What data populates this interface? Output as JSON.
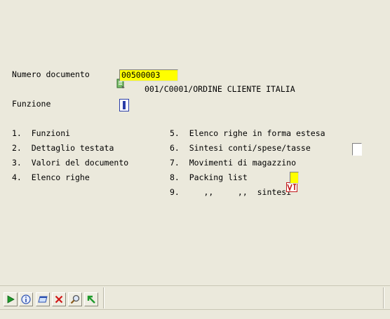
{
  "header": {
    "numero_label": "Numero documento",
    "numero_value": "00500003",
    "doc_description": "001/C0001/ORDINE CLIENTE ITALIA",
    "funzione_label": "Funzione"
  },
  "menu_left": [
    "1.  Funzioni",
    "2.  Dettaglio testata",
    "3.  Valori del documento",
    "4.  Elenco righe"
  ],
  "menu_right": [
    "5.  Elenco righe in forma estesa",
    "6.  Sintesi conti/spese/tasse",
    "7.  Movimenti di magazzino",
    "8.  Packing list",
    "9.     ,,     ,,  sintesi"
  ],
  "colors": {
    "background": "#ebe9dc",
    "field_yellow": "#ffff00",
    "cursor_blue": "#2b3ea8"
  },
  "toolbar_icons": [
    "play-icon",
    "info-icon",
    "window-icon",
    "delete-icon",
    "search-icon",
    "back-icon"
  ]
}
